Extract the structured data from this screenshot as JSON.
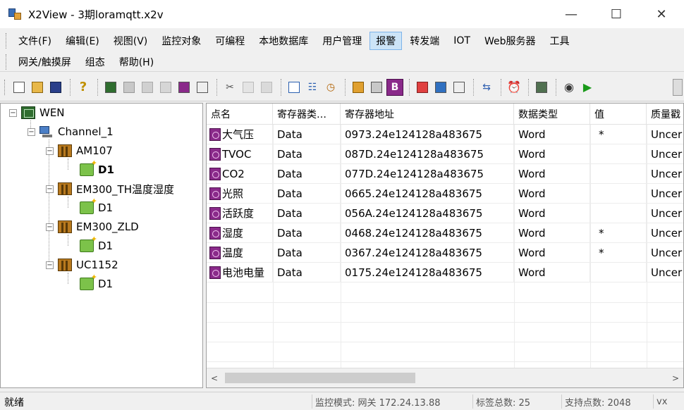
{
  "window": {
    "title": "X2View - 3期loramqtt.x2v",
    "minimize": "—",
    "maximize": "☐",
    "close": "✕"
  },
  "menu": {
    "row1": [
      "文件(F)",
      "编辑(E)",
      "视图(V)",
      "监控对象",
      "可编程",
      "本地数据库",
      "用户管理",
      "报警",
      "转发端",
      "IOT",
      "Web服务器",
      "工具"
    ],
    "row2": [
      "网关/触摸屏",
      "组态",
      "帮助(H)"
    ],
    "active": "报警"
  },
  "tree": {
    "root": "WEN",
    "channel": "Channel_1",
    "devices": [
      {
        "name": "AM107",
        "child": "D1"
      },
      {
        "name": "EM300_TH温度湿度",
        "child": "D1"
      },
      {
        "name": "EM300_ZLD",
        "child": "D1"
      },
      {
        "name": "UC1152",
        "child": "D1"
      }
    ]
  },
  "table": {
    "columns": [
      "点名",
      "寄存器类…",
      "寄存器地址",
      "数据类型",
      "值",
      "质量戳"
    ],
    "rows": [
      {
        "name": "大气压",
        "reg_type": "Data",
        "address": "0973.24e124128a483675",
        "dtype": "Word",
        "value": "*",
        "quality": "Uncer"
      },
      {
        "name": "TVOC",
        "reg_type": "Data",
        "address": "087D.24e124128a483675",
        "dtype": "Word",
        "value": "",
        "quality": "Uncer"
      },
      {
        "name": "CO2",
        "reg_type": "Data",
        "address": "077D.24e124128a483675",
        "dtype": "Word",
        "value": "",
        "quality": "Uncer"
      },
      {
        "name": "光照",
        "reg_type": "Data",
        "address": "0665.24e124128a483675",
        "dtype": "Word",
        "value": "",
        "quality": "Uncer"
      },
      {
        "name": "活跃度",
        "reg_type": "Data",
        "address": "056A.24e124128a483675",
        "dtype": "Word",
        "value": "",
        "quality": "Uncer"
      },
      {
        "name": "湿度",
        "reg_type": "Data",
        "address": "0468.24e124128a483675",
        "dtype": "Word",
        "value": "*",
        "quality": "Uncer"
      },
      {
        "name": "温度",
        "reg_type": "Data",
        "address": "0367.24e124128a483675",
        "dtype": "Word",
        "value": "*",
        "quality": "Uncer"
      },
      {
        "name": "电池电量",
        "reg_type": "Data",
        "address": "0175.24e124128a483675",
        "dtype": "Word",
        "value": "",
        "quality": "Uncer"
      }
    ]
  },
  "scroll": {
    "left": "<",
    "right": ">"
  },
  "status": {
    "ready": "就绪",
    "mode": "监控模式: 网关 172.24.13.88",
    "tag_total": "标签总数: 25",
    "support_points": "支持点数: 2048",
    "extra": "vx"
  },
  "colors": {
    "menu_active_bg": "#cce4f7",
    "tag_icon": "#8a2a8a"
  }
}
